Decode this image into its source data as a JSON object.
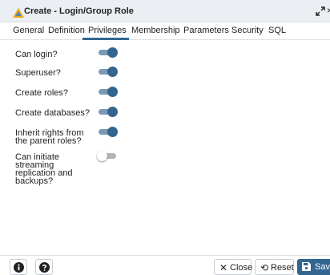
{
  "dialog": {
    "title": "Create - Login/Group Role",
    "title_icon": "role-group-icon",
    "expand_icon": "expand-icon",
    "close_glyph": "×"
  },
  "tabs": [
    {
      "label": "General",
      "active": false
    },
    {
      "label": "Definition",
      "active": false
    },
    {
      "label": "Privileges",
      "active": true
    },
    {
      "label": "Membership",
      "active": false
    },
    {
      "label": "Parameters",
      "active": false
    },
    {
      "label": "Security",
      "active": false
    },
    {
      "label": "SQL",
      "active": false
    }
  ],
  "privileges": [
    {
      "label": [
        "Can login?"
      ],
      "enabled": true
    },
    {
      "label": [
        "Superuser?"
      ],
      "enabled": true
    },
    {
      "label": [
        "Create roles?"
      ],
      "enabled": true
    },
    {
      "label": [
        "Create databases?"
      ],
      "enabled": true
    },
    {
      "label": [
        "Inherit rights from",
        "the parent roles?"
      ],
      "enabled": true
    },
    {
      "label": [
        "Can initiate",
        "streaming",
        "replication and",
        "backups?"
      ],
      "enabled": false
    }
  ],
  "footer": {
    "info_icon": "info-icon",
    "help_icon": "help-icon",
    "close_label": "Close",
    "reset_label": "Reset",
    "save_label": "Save"
  },
  "colors": {
    "accent": "#326690",
    "toggle_track_on": "#7b98b4",
    "toggle_track_off": "#b3b3b3"
  }
}
